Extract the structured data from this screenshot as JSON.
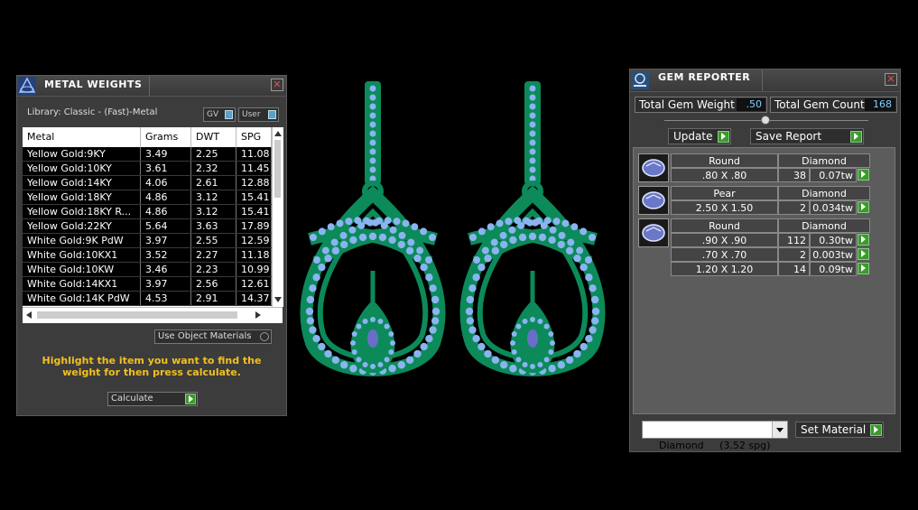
{
  "metal_weights": {
    "title": "METAL WEIGHTS",
    "library_label": "Library: Classic - (Fast)-Metal",
    "toggle_gv": "GV",
    "toggle_user": "User",
    "columns": [
      "Metal",
      "Grams",
      "DWT",
      "SPG"
    ],
    "rows": [
      [
        "Yellow Gold:9KY",
        "3.49",
        "2.25",
        "11.08"
      ],
      [
        "Yellow Gold:10KY",
        "3.61",
        "2.32",
        "11.45"
      ],
      [
        "Yellow Gold:14KY",
        "4.06",
        "2.61",
        "12.88"
      ],
      [
        "Yellow Gold:18KY",
        "4.86",
        "3.12",
        "15.41"
      ],
      [
        "Yellow Gold:18KY R...",
        "4.86",
        "3.12",
        "15.41"
      ],
      [
        "Yellow Gold:22KY",
        "5.64",
        "3.63",
        "17.89"
      ],
      [
        "White Gold:9K PdW",
        "3.97",
        "2.55",
        "12.59"
      ],
      [
        "White Gold:10KX1",
        "3.52",
        "2.27",
        "11.18"
      ],
      [
        "White Gold:10KW",
        "3.46",
        "2.23",
        "10.99"
      ],
      [
        "White Gold:14KX1",
        "3.97",
        "2.56",
        "12.61"
      ],
      [
        "White Gold:14K PdW",
        "4.53",
        "2.91",
        "14.37"
      ]
    ],
    "use_object_materials": "Use Object Materials",
    "hint": "Highlight the item you want to find the weight for then press calculate.",
    "calculate_label": "Calculate"
  },
  "gem_reporter": {
    "title": "GEM REPORTER",
    "total_weight_label": "Total Gem Weight",
    "total_weight_value": ".50",
    "total_count_label": "Total Gem Count",
    "total_count_value": "168",
    "update_label": "Update",
    "save_report_label": "Save Report",
    "groups": [
      {
        "shape": "Round",
        "material": "Diamond",
        "rows": [
          [
            ".80 X .80",
            "38",
            "0.07tw"
          ]
        ]
      },
      {
        "shape": "Pear",
        "material": "Diamond",
        "rows": [
          [
            "2.50 X 1.50",
            "2",
            "0.034tw"
          ]
        ]
      },
      {
        "shape": "Round",
        "material": "Diamond",
        "rows": [
          [
            ".90 X .90",
            "112",
            "0.30tw"
          ],
          [
            ".70 X .70",
            "2",
            "0.003tw"
          ],
          [
            "1.20 X 1.20",
            "14",
            "0.09tw"
          ]
        ]
      }
    ],
    "material_select": "Diamond     (3.52 spg)",
    "set_material_label": "Set Material"
  },
  "colors": {
    "metal": "#0c8a5a",
    "gem": "#8ab4f0",
    "accent": "#3c9a2c",
    "hint": "#f2c020"
  }
}
